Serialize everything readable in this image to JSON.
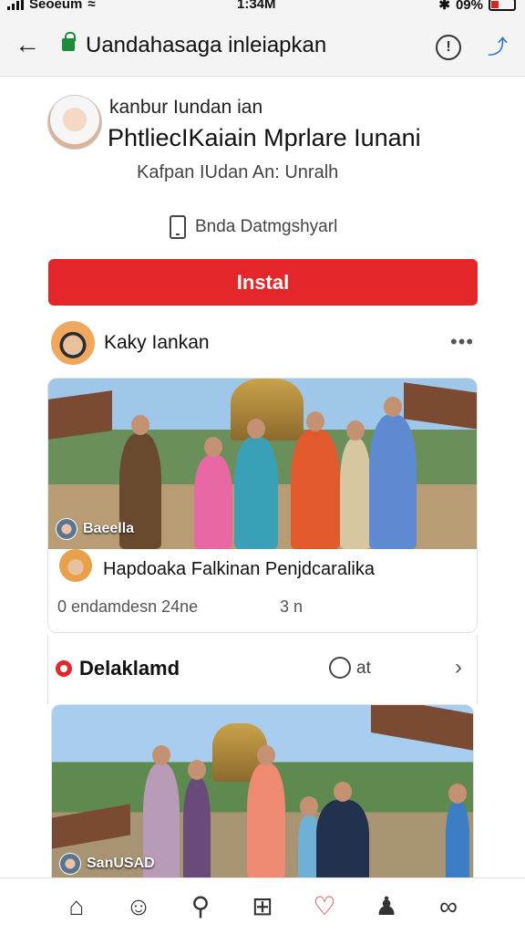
{
  "status_bar": {
    "carrier": "Seoeum",
    "time": "1:34M",
    "battery": "09%"
  },
  "browser": {
    "url": "Uandahasaga inleiapkan",
    "back_icon": "back-arrow-icon",
    "info_icon": "info-icon",
    "share_icon": "share-icon"
  },
  "profile": {
    "name": "kanbur Iundan ian",
    "title": "PhtliecIKaiain Mprlare Iunani",
    "subtitle": "Kafpan IUdan An: Unralh",
    "device_text": "Bnda Datmgshyarl"
  },
  "install_button": "Instal",
  "post": {
    "author": "Kaky Iankan",
    "card1": {
      "overlay_label": "Baeella",
      "title": "Hapdoaka Falkinan Penjdcaralika",
      "meta": "0 endamdesn 24ne",
      "meta2": "3 n"
    }
  },
  "section2": {
    "title": "Delaklamd",
    "comment_text": "at",
    "card2_overlay": "SanUSAD"
  },
  "bottom_nav": {
    "items": [
      "home-icon",
      "profile-icon",
      "search-icon",
      "add-icon",
      "heart-icon",
      "people-icon",
      "more-icon"
    ],
    "active_color": "#e3262a"
  },
  "colors": {
    "accent": "#e3262a",
    "lock": "#1f8a3a",
    "link_blue": "#2a6fd6"
  }
}
